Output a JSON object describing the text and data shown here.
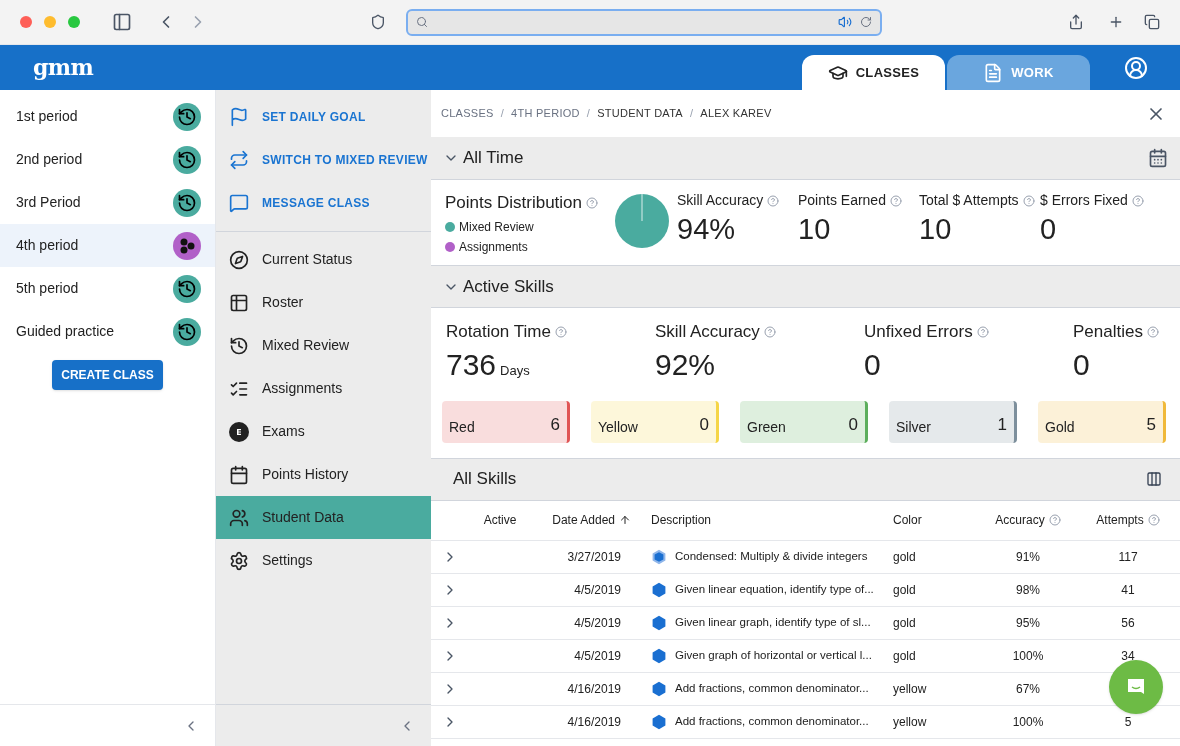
{
  "header": {
    "logo": "gmm",
    "tabs": [
      {
        "label": "CLASSES",
        "selected": true
      },
      {
        "label": "WORK",
        "selected": false
      }
    ]
  },
  "classes": [
    {
      "name": "1st period",
      "selected": false,
      "kind": "history",
      "color": "#4aab9f"
    },
    {
      "name": "2nd period",
      "selected": false,
      "kind": "history",
      "color": "#4aab9f"
    },
    {
      "name": "3rd Period",
      "selected": false,
      "kind": "history",
      "color": "#4aab9f"
    },
    {
      "name": "4th period",
      "selected": true,
      "kind": "group",
      "color": "#b160c8"
    },
    {
      "name": "5th period",
      "selected": false,
      "kind": "history",
      "color": "#4aab9f"
    },
    {
      "name": "Guided practice",
      "selected": false,
      "kind": "history",
      "color": "#4aab9f"
    }
  ],
  "create_class_button": "CREATE CLASS",
  "class_actions": [
    "SET DAILY GOAL",
    "SWITCH TO MIXED REVIEW",
    "MESSAGE CLASS"
  ],
  "class_nav": [
    {
      "label": "Current Status",
      "selected": false
    },
    {
      "label": "Roster",
      "selected": false
    },
    {
      "label": "Mixed Review",
      "selected": false
    },
    {
      "label": "Assignments",
      "selected": false
    },
    {
      "label": "Exams",
      "selected": false
    },
    {
      "label": "Points History",
      "selected": false
    },
    {
      "label": "Student Data",
      "selected": true
    },
    {
      "label": "Settings",
      "selected": false
    }
  ],
  "breadcrumb": [
    {
      "label": "CLASSES",
      "current": false
    },
    {
      "separator": "/",
      "label": "4TH PERIOD",
      "current": false
    },
    {
      "separator": "/",
      "label": "STUDENT DATA",
      "current": true
    },
    {
      "separator": "/",
      "label": "ALEX KAREV",
      "current": true
    }
  ],
  "all_time": {
    "title": "All Time",
    "distribution": {
      "title": "Points Distribution",
      "legend": [
        {
          "label": "Mixed Review",
          "color": "#4aab9f"
        },
        {
          "label": "Assignments",
          "color": "#b160c8"
        }
      ]
    },
    "stats": [
      {
        "label": "Skill Accuracy",
        "value": "94%"
      },
      {
        "label": "Points Earned",
        "value": "10"
      },
      {
        "label": "Total $ Attempts",
        "value": "10"
      },
      {
        "label": "$ Errors Fixed",
        "value": "0"
      }
    ]
  },
  "active_skills": {
    "title": "Active Skills",
    "stats": [
      {
        "label": "Rotation Time",
        "value": "736",
        "unit": "Days"
      },
      {
        "label": "Skill Accuracy",
        "value": "92%"
      },
      {
        "label": "Unfixed Errors",
        "value": "0"
      },
      {
        "label": "Penalties",
        "value": "0"
      }
    ],
    "counters": [
      {
        "label": "Red",
        "count": "6",
        "color": "#e05555"
      },
      {
        "label": "Yellow",
        "count": "0",
        "color": "#f5d547"
      },
      {
        "label": "Green",
        "count": "0",
        "color": "#5cae5c"
      },
      {
        "label": "Silver",
        "count": "1",
        "color": "#7d8f9c"
      },
      {
        "label": "Gold",
        "count": "5",
        "color": "#f0b93a"
      }
    ]
  },
  "all_skills": {
    "title": "All Skills",
    "columns": [
      "Active",
      "Date Added",
      "Description",
      "Color",
      "Accuracy",
      "Attempts"
    ],
    "rows": [
      {
        "date": "3/27/2019",
        "kind": "outline",
        "description": "Condensed: Multiply & divide integers",
        "color_name": "gold",
        "accuracy": "91%",
        "attempts": "117"
      },
      {
        "date": "4/5/2019",
        "kind": "filled",
        "description": "Given linear equation, identify type of...",
        "color_name": "gold",
        "accuracy": "98%",
        "attempts": "41"
      },
      {
        "date": "4/5/2019",
        "kind": "filled",
        "description": "Given linear graph, identify type of sl...",
        "color_name": "gold",
        "accuracy": "95%",
        "attempts": "56"
      },
      {
        "date": "4/5/2019",
        "kind": "filled",
        "description": "Given graph of horizontal or vertical l...",
        "color_name": "gold",
        "accuracy": "100%",
        "attempts": "34"
      },
      {
        "date": "4/16/2019",
        "kind": "filled",
        "description": "Add fractions, common denominator...",
        "color_name": "yellow",
        "accuracy": "67%"
      },
      {
        "date": "4/16/2019",
        "kind": "filled",
        "description": "Add fractions, common denominator...",
        "color_name": "yellow",
        "accuracy": "100%",
        "attempts": "5"
      }
    ]
  }
}
